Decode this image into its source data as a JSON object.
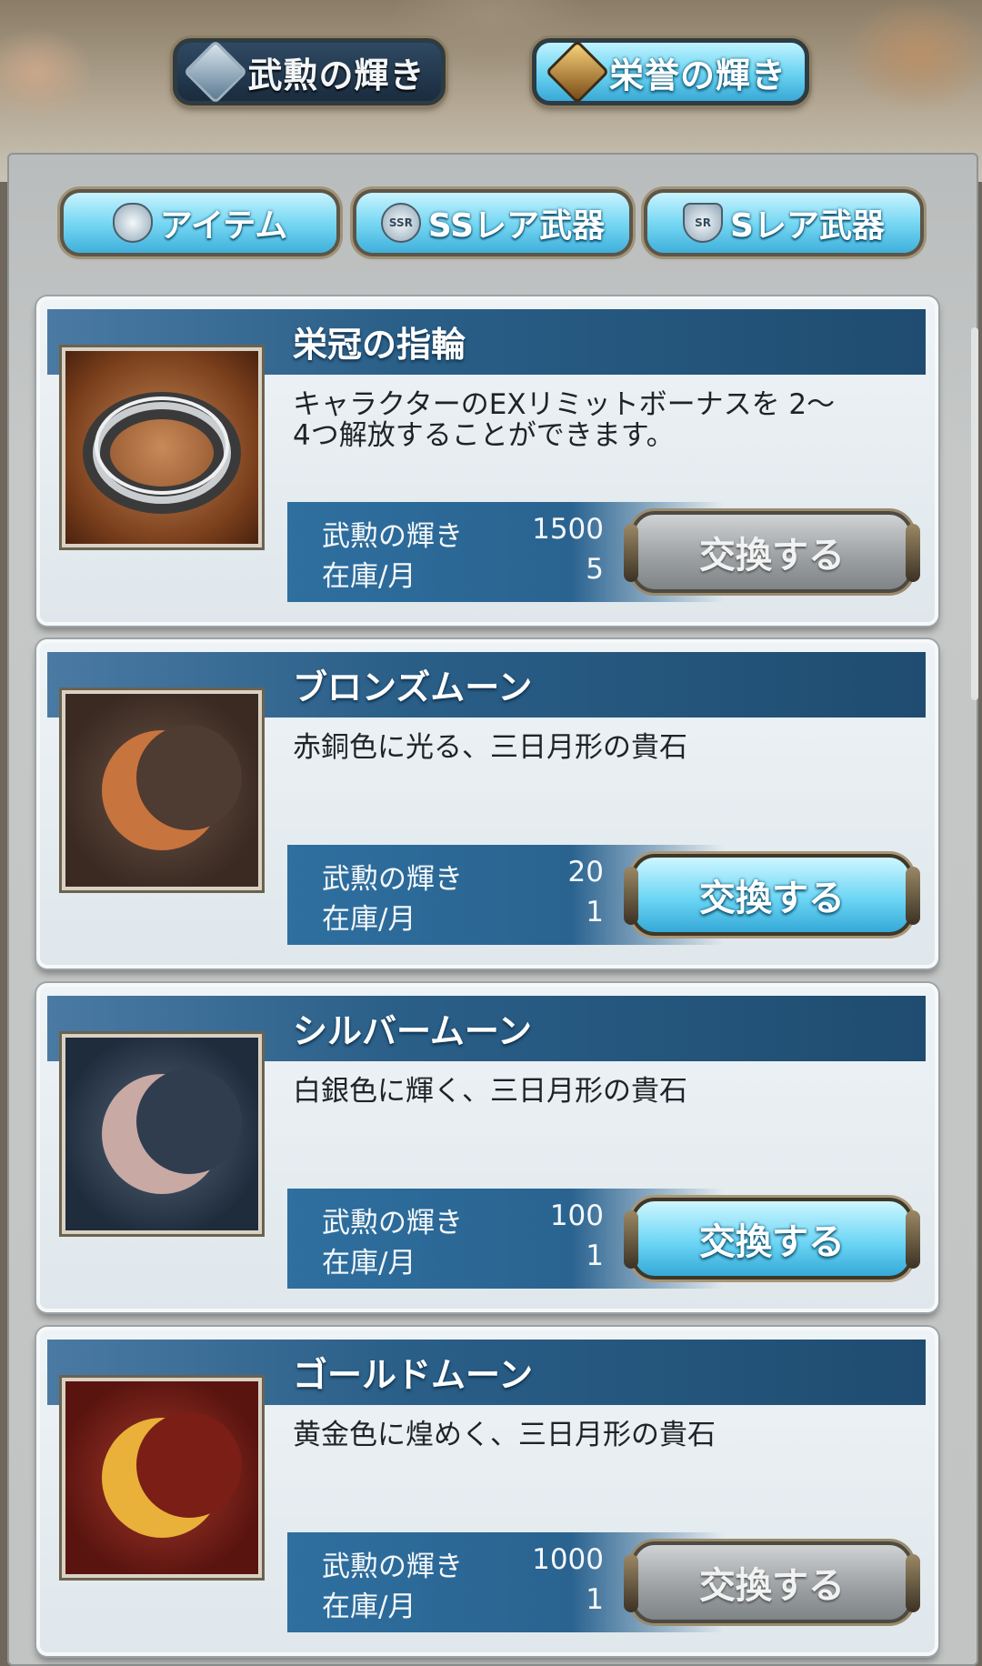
{
  "top_tabs": [
    {
      "label": "武勲の輝き",
      "icon": "buken-gem-icon",
      "active": true
    },
    {
      "label": "栄誉の輝き",
      "icon": "eiyo-gem-icon",
      "active": false
    }
  ],
  "sub_tabs": [
    {
      "label": "アイテム",
      "icon": "potion-icon"
    },
    {
      "label": "SSレア武器",
      "icon": "ssr-badge-icon",
      "badge": "SSR"
    },
    {
      "label": "Sレア武器",
      "icon": "sr-badge-icon",
      "badge": "SR"
    }
  ],
  "items": [
    {
      "name": "栄冠の指輪",
      "icon": "ring-icon",
      "description": "キャラクターのEXリミットボーナスを 2〜4つ解放することができます。",
      "cost_label": "武勲の輝き",
      "cost": "1500",
      "stock_label": "在庫/月",
      "stock": "5",
      "button": "交換する",
      "button_enabled": false
    },
    {
      "name": "ブロンズムーン",
      "icon": "bronze-moon-icon",
      "description": "赤銅色に光る、三日月形の貴石",
      "cost_label": "武勲の輝き",
      "cost": "20",
      "stock_label": "在庫/月",
      "stock": "1",
      "button": "交換する",
      "button_enabled": true
    },
    {
      "name": "シルバームーン",
      "icon": "silver-moon-icon",
      "description": "白銀色に輝く、三日月形の貴石",
      "cost_label": "武勲の輝き",
      "cost": "100",
      "stock_label": "在庫/月",
      "stock": "1",
      "button": "交換する",
      "button_enabled": true
    },
    {
      "name": "ゴールドムーン",
      "icon": "gold-moon-icon",
      "description": "黄金色に煌めく、三日月形の貴石",
      "cost_label": "武勲の輝き",
      "cost": "1000",
      "stock_label": "在庫/月",
      "stock": "1",
      "button": "交換する",
      "button_enabled": false
    }
  ]
}
